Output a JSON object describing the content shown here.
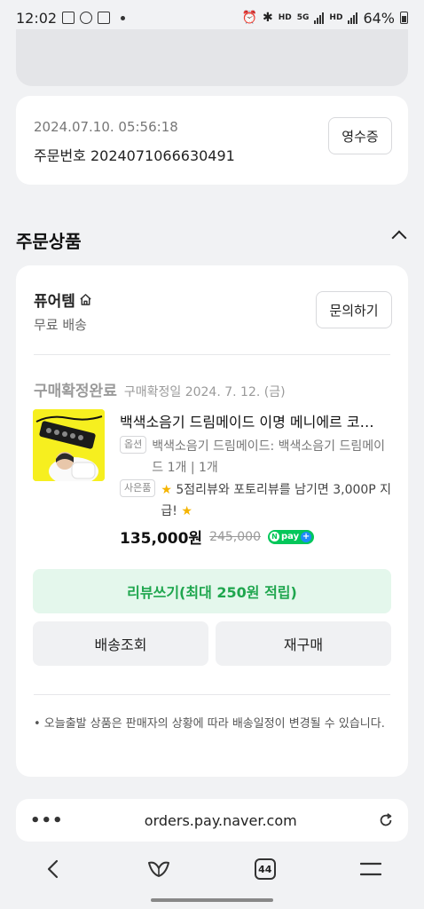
{
  "status_bar": {
    "time": "12:02",
    "battery": "64%",
    "signal_label_1": "HD",
    "signal_label_2": "5G",
    "signal_label_3": "HD"
  },
  "order": {
    "datetime": "2024.07.10. 05:56:18",
    "number_text": "주문번호 2024071066630491",
    "receipt_label": "영수증"
  },
  "section": {
    "title": "주문상품"
  },
  "seller": {
    "name": "퓨어템",
    "shipping": "무료 배송",
    "inquiry_label": "문의하기"
  },
  "item": {
    "status": "구매확정완료",
    "status_date": "구매확정일 2024. 7. 12. (금)",
    "name": "백색소음기 드림메이드 이명 메니에르 코…",
    "option_tag": "옵션",
    "option_text": "백색소음기 드림메이드: 백색소음기 드림메이드 1개 | 1개",
    "gift_tag": "사은품",
    "gift_text": "5점리뷰와 포토리뷰를 남기면 3,000P 지급!",
    "price": "135,000원",
    "original_price": "245,000",
    "npay_label": "pay"
  },
  "actions": {
    "review_label": "리뷰쓰기(최대 250원 적립)",
    "shipping_label": "배송조회",
    "rebuy_label": "재구매"
  },
  "notice": "• 오늘출발 상품은 판매자의 상황에 따라 배송일정이 변경될 수 있습니다.",
  "browser": {
    "url": "orders.pay.naver.com",
    "tab_count": "44",
    "menu_dots": "•••"
  },
  "colors": {
    "accent_green": "#1fa64e",
    "review_bg": "#e4f7ec",
    "npay_green": "#03c75a",
    "star": "#f5b400"
  }
}
